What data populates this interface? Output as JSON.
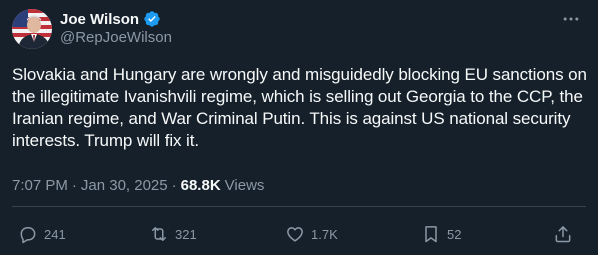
{
  "author": {
    "display_name": "Joe Wilson",
    "handle": "@RepJoeWilson",
    "verified_icon": "verified-badge-icon",
    "avatar": "avatar-photo"
  },
  "tweet": {
    "text": "Slovakia and Hungary are wrongly and misguidedly blocking EU sanctions on the illegitimate Ivanishvili regime, which is selling out Georgia to the CCP, the Iranian regime, and War Criminal Putin. This is against US national security interests. Trump will fix it."
  },
  "meta": {
    "time": "7:07 PM",
    "separator": "·",
    "date": "Jan 30, 2025",
    "views_count": "68.8K",
    "views_label": "Views"
  },
  "actions": {
    "reply_count": "241",
    "retweet_count": "321",
    "like_count": "1.7K",
    "bookmark_count": "52"
  },
  "colors": {
    "background": "#15202b",
    "text": "#f7f9f9",
    "secondary": "#8b98a5",
    "verified": "#1d9bf0",
    "divider": "#38444d"
  }
}
